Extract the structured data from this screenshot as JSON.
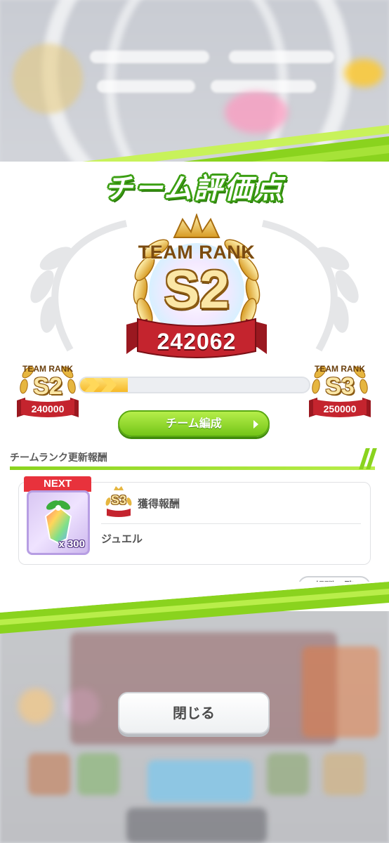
{
  "modal": {
    "title": "チーム評価点",
    "current_rank": {
      "heading": "TEAM RANK",
      "rank": "S2",
      "score": "242062"
    },
    "progress": {
      "from": {
        "heading": "TEAM RANK",
        "rank": "S2",
        "score": "240000"
      },
      "to": {
        "heading": "TEAM RANK",
        "rank": "S3",
        "score": "250000"
      },
      "fraction": 0.21
    },
    "team_button_label": "チーム編成",
    "rewards": {
      "section_title": "チームランク更新報酬",
      "next_tag": "NEXT",
      "badge_rank": "S3",
      "title": "獲得報酬",
      "item_name": "ジュエル",
      "item_quantity": "x 300",
      "list_button_label": "報酬一覧"
    },
    "close_button_label": "閉じる"
  },
  "colors": {
    "accent_green": "#8ad31e",
    "ribbon_red": "#c4242e",
    "gold": "#e6b640",
    "next_red": "#e8323c"
  }
}
